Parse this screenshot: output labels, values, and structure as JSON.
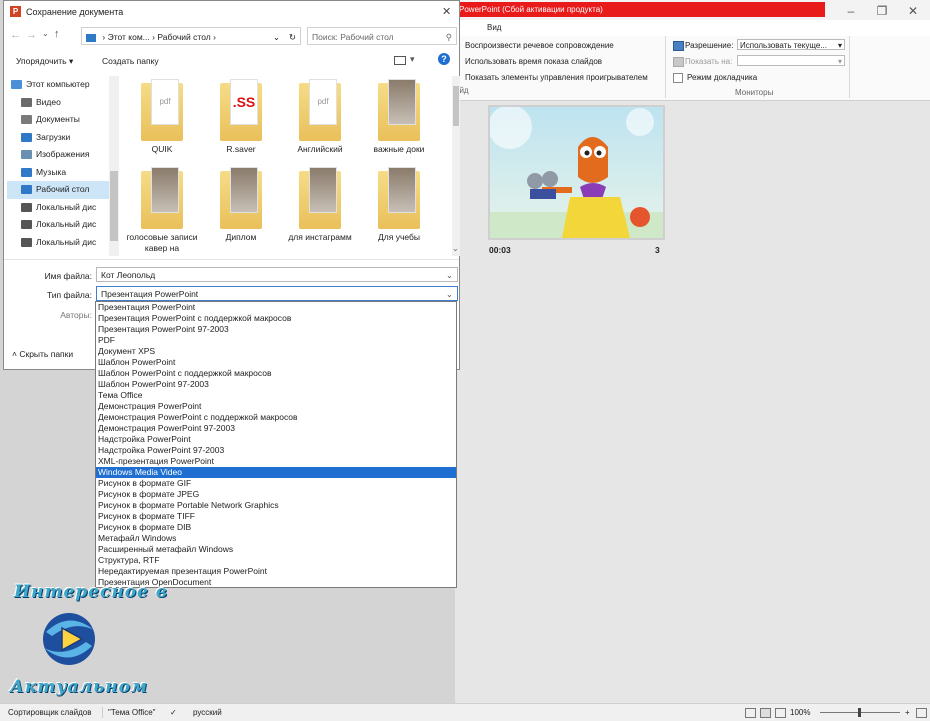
{
  "powerpoint": {
    "title_fragment": "PowerPoint (Сбой активации продукта)",
    "tab_view": "Вид",
    "ribbon": {
      "voice_over": "Воспроизвести речевое сопровождение",
      "use_timings": "Использовать время показа слайдов",
      "show_controls": "Показать элементы управления проигрывателем",
      "group_fragment": "айд",
      "resolution_label": "Разрешение:",
      "resolution_value": "Использовать текуще...",
      "show_on_label": "Показать на:",
      "presenter_mode": "Режим докладчика",
      "monitors_group": "Мониторы"
    },
    "slide": {
      "time": "00:03",
      "number": "3"
    }
  },
  "dialog": {
    "title": "Сохранение документа",
    "address": [
      "Этот ком...",
      "Рабочий стол"
    ],
    "search_placeholder": "Поиск: Рабочий стол",
    "organize": "Упорядочить",
    "new_folder": "Создать папку",
    "tree": [
      {
        "label": "Этот компьютер",
        "icon": "computer-icon",
        "color": "#4a90d9"
      },
      {
        "label": "Видео",
        "icon": "video-icon",
        "color": "#6a6a6a"
      },
      {
        "label": "Документы",
        "icon": "documents-icon",
        "color": "#7a7a7a"
      },
      {
        "label": "Загрузки",
        "icon": "downloads-icon",
        "color": "#2f79c6"
      },
      {
        "label": "Изображения",
        "icon": "pictures-icon",
        "color": "#6a8fb0"
      },
      {
        "label": "Музыка",
        "icon": "music-icon",
        "color": "#2f79c6"
      },
      {
        "label": "Рабочий стол",
        "icon": "desktop-icon",
        "color": "#2f79c6"
      },
      {
        "label": "Локальный дис",
        "icon": "drive-icon",
        "color": "#555555"
      },
      {
        "label": "Локальный дис",
        "icon": "drive-icon",
        "color": "#555555"
      },
      {
        "label": "Локальный дис",
        "icon": "drive-icon",
        "color": "#555555"
      }
    ],
    "files": [
      {
        "label": "QUIK",
        "doc": "pdf"
      },
      {
        "label": "R.saver",
        "doc": ".SS"
      },
      {
        "label": "Английский",
        "doc": "pdf"
      },
      {
        "label": "важные доки",
        "doc": ""
      },
      {
        "label": "голосовые записи кавер на",
        "doc": ""
      },
      {
        "label": "Диплом",
        "doc": ""
      },
      {
        "label": "для инстаграмм",
        "doc": ""
      },
      {
        "label": "Для учебы",
        "doc": ""
      }
    ],
    "filename_label": "Имя файла:",
    "filename_value": "Кот Леопольд",
    "filetype_label": "Тип файла:",
    "filetype_value": "Презентация PowerPoint",
    "authors_label": "Авторы:",
    "hide_folders": "Скрыть папки",
    "filetype_options": [
      "Презентация PowerPoint",
      "Презентация PowerPoint с поддержкой макросов",
      "Презентация PowerPoint 97-2003",
      "PDF",
      "Документ XPS",
      "Шаблон PowerPoint",
      "Шаблон PowerPoint с поддержкой макросов",
      "Шаблон PowerPoint 97-2003",
      "Тема Office",
      "Демонстрация PowerPoint",
      "Демонстрация PowerPoint с поддержкой макросов",
      "Демонстрация PowerPoint 97-2003",
      "Надстройка PowerPoint",
      "Надстройка PowerPoint 97-2003",
      "XML-презентация PowerPoint",
      "Windows Media Video",
      "Рисунок в формате GIF",
      "Рисунок в формате JPEG",
      "Рисунок в формате Portable Network Graphics",
      "Рисунок в формате TIFF",
      "Рисунок в формате DIB",
      "Метафайл Windows",
      "Расширенный метафайл Windows",
      "Структура, RTF",
      "Нередактируемая презентация PowerPoint",
      "Презентация OpenDocument"
    ],
    "selected_option": "Windows Media Video"
  },
  "statusbar": {
    "view": "Сортировщик слайдов",
    "theme": "\"Тема Office\"",
    "language": "русский",
    "zoom": "100%"
  },
  "watermark": {
    "line1": "Интересное в",
    "line2": "Актуальном"
  },
  "colors": {
    "accent": "#1e6fd1",
    "error_bar": "#e81a1a",
    "folder": "#f0cf6e"
  }
}
